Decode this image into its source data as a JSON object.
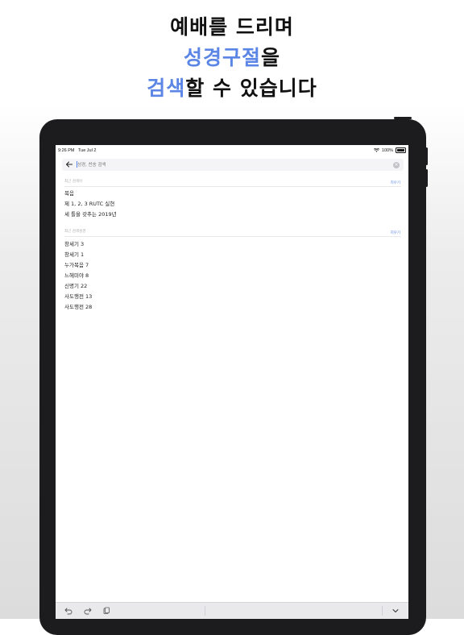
{
  "promo": {
    "line1": "예배를 드리며",
    "line2_accent": "성경구절",
    "line2_rest": "을",
    "line3_accent": "검색",
    "line3_rest": "할 수 있습니다",
    "accent_color": "#5b86e5"
  },
  "status_bar": {
    "time": "9:26 PM",
    "date": "Tue Jul 2",
    "battery": "100%"
  },
  "search": {
    "placeholder": "성경, 찬송 검색"
  },
  "recent_searches": {
    "label": "최근 검색어",
    "clear_label": "지우기",
    "items": [
      "복음",
      "제 1, 2, 3 RUTC 실현",
      "세 틀을 갖추는 2019년"
    ]
  },
  "recent_verses": {
    "label": "최근 검색성경",
    "clear_label": "지우기",
    "items": [
      "창세기 3",
      "창세기 1",
      "누가복음 7",
      "느헤미야 8",
      "신명기 22",
      "사도행전 13",
      "사도행전 28"
    ]
  }
}
